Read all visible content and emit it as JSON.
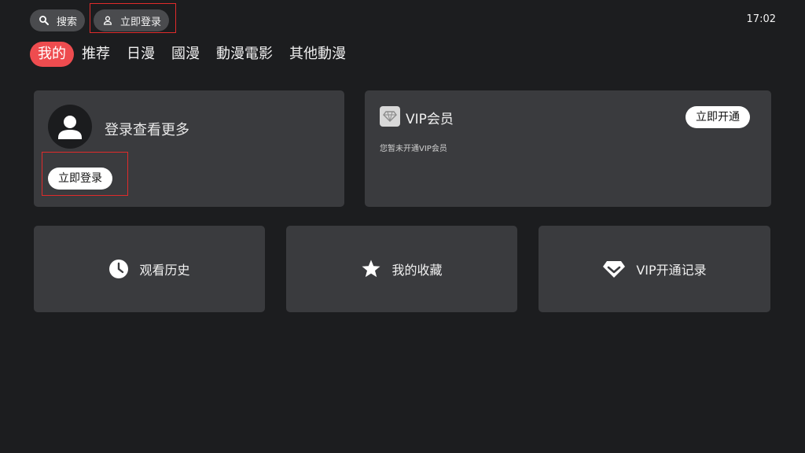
{
  "header": {
    "search_label": "搜索",
    "login_label": "立即登录",
    "time": "17:02"
  },
  "tabs": [
    {
      "label": "我的",
      "active": true
    },
    {
      "label": "推荐",
      "active": false
    },
    {
      "label": "日漫",
      "active": false
    },
    {
      "label": "國漫",
      "active": false
    },
    {
      "label": "動漫電影",
      "active": false
    },
    {
      "label": "其他動漫",
      "active": false
    }
  ],
  "login_card": {
    "title": "登录查看更多",
    "button": "立即登录"
  },
  "vip_card": {
    "title": "VIP会员",
    "subtitle": "您暂未开通VIP会员",
    "button": "立即开通"
  },
  "shortcuts": [
    {
      "label": "观看历史",
      "icon": "clock-icon"
    },
    {
      "label": "我的收藏",
      "icon": "star-icon"
    },
    {
      "label": "VIP开通记录",
      "icon": "diamond-icon"
    }
  ],
  "colors": {
    "background": "#1c1d1f",
    "card": "#3a3b3e",
    "accent": "#ee4c4f",
    "highlight": "#e02b2b"
  }
}
